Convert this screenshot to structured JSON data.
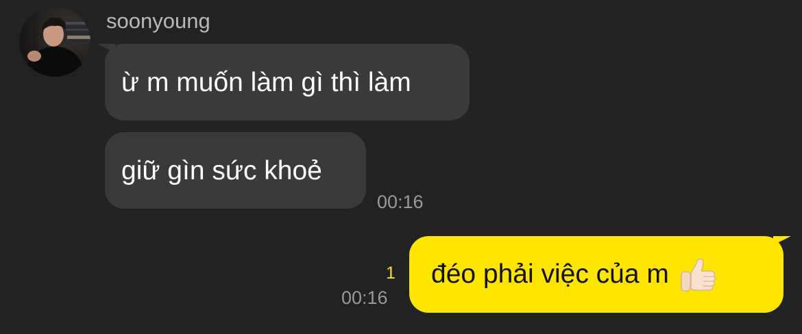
{
  "chat": {
    "sender_name": "soonyoung",
    "messages_in": [
      {
        "text": "ừ m muốn làm gì thì làm"
      },
      {
        "text": "giữ gìn sức khoẻ"
      }
    ],
    "in_time": "00:16",
    "message_out": {
      "text": "đéo phải việc của m",
      "emoji": "thumbs-up-light-skin-tone",
      "unread_count": "1",
      "time": "00:16"
    }
  },
  "colors": {
    "background": "#222224",
    "incoming_bubble": "#3a3a3c",
    "outgoing_bubble": "#fee500",
    "unread_count": "#f7e024",
    "timestamp": "#9a9a9d",
    "sender_name": "#b9b9bb"
  }
}
